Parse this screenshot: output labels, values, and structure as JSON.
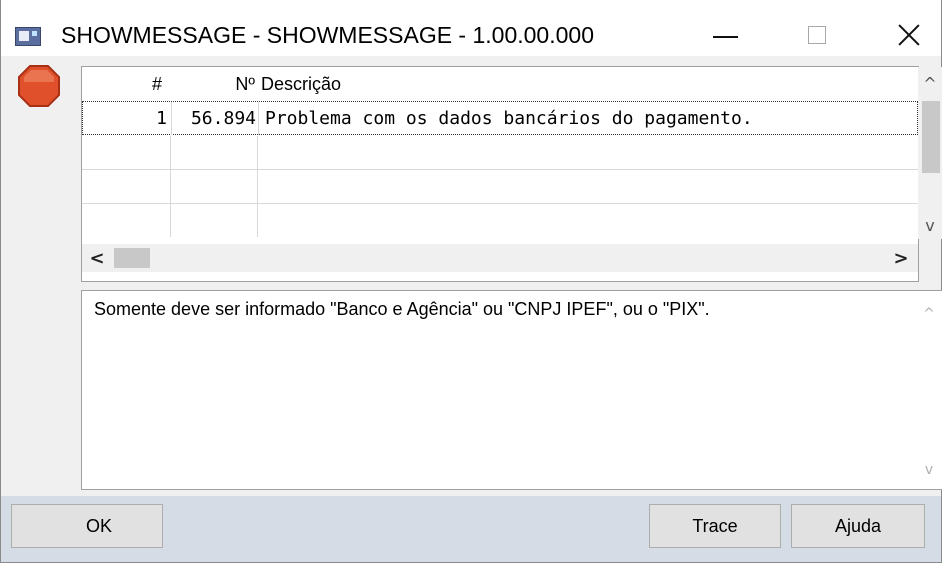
{
  "window": {
    "title": "SHOWMESSAGE - SHOWMESSAGE - 1.00.00.000",
    "icon": "app-window-icon"
  },
  "grid": {
    "columns": [
      "#",
      "Nº",
      "Descrição"
    ],
    "rows": [
      {
        "index": "1",
        "number": "56.894",
        "description": "Problema com os dados bancários do pagamento."
      }
    ]
  },
  "details": {
    "text": "Somente deve ser informado \"Banco e Agência\" ou \"CNPJ IPEF\", ou o \"PIX\"."
  },
  "buttons": {
    "ok": "OK",
    "trace": "Trace",
    "help": "Ajuda"
  },
  "scroll_glyphs": {
    "up": "^",
    "down": "v",
    "left": "<",
    "right": ">"
  },
  "colors": {
    "stop_icon": "#e0502a",
    "bottom_bar": "#d6dce6"
  }
}
